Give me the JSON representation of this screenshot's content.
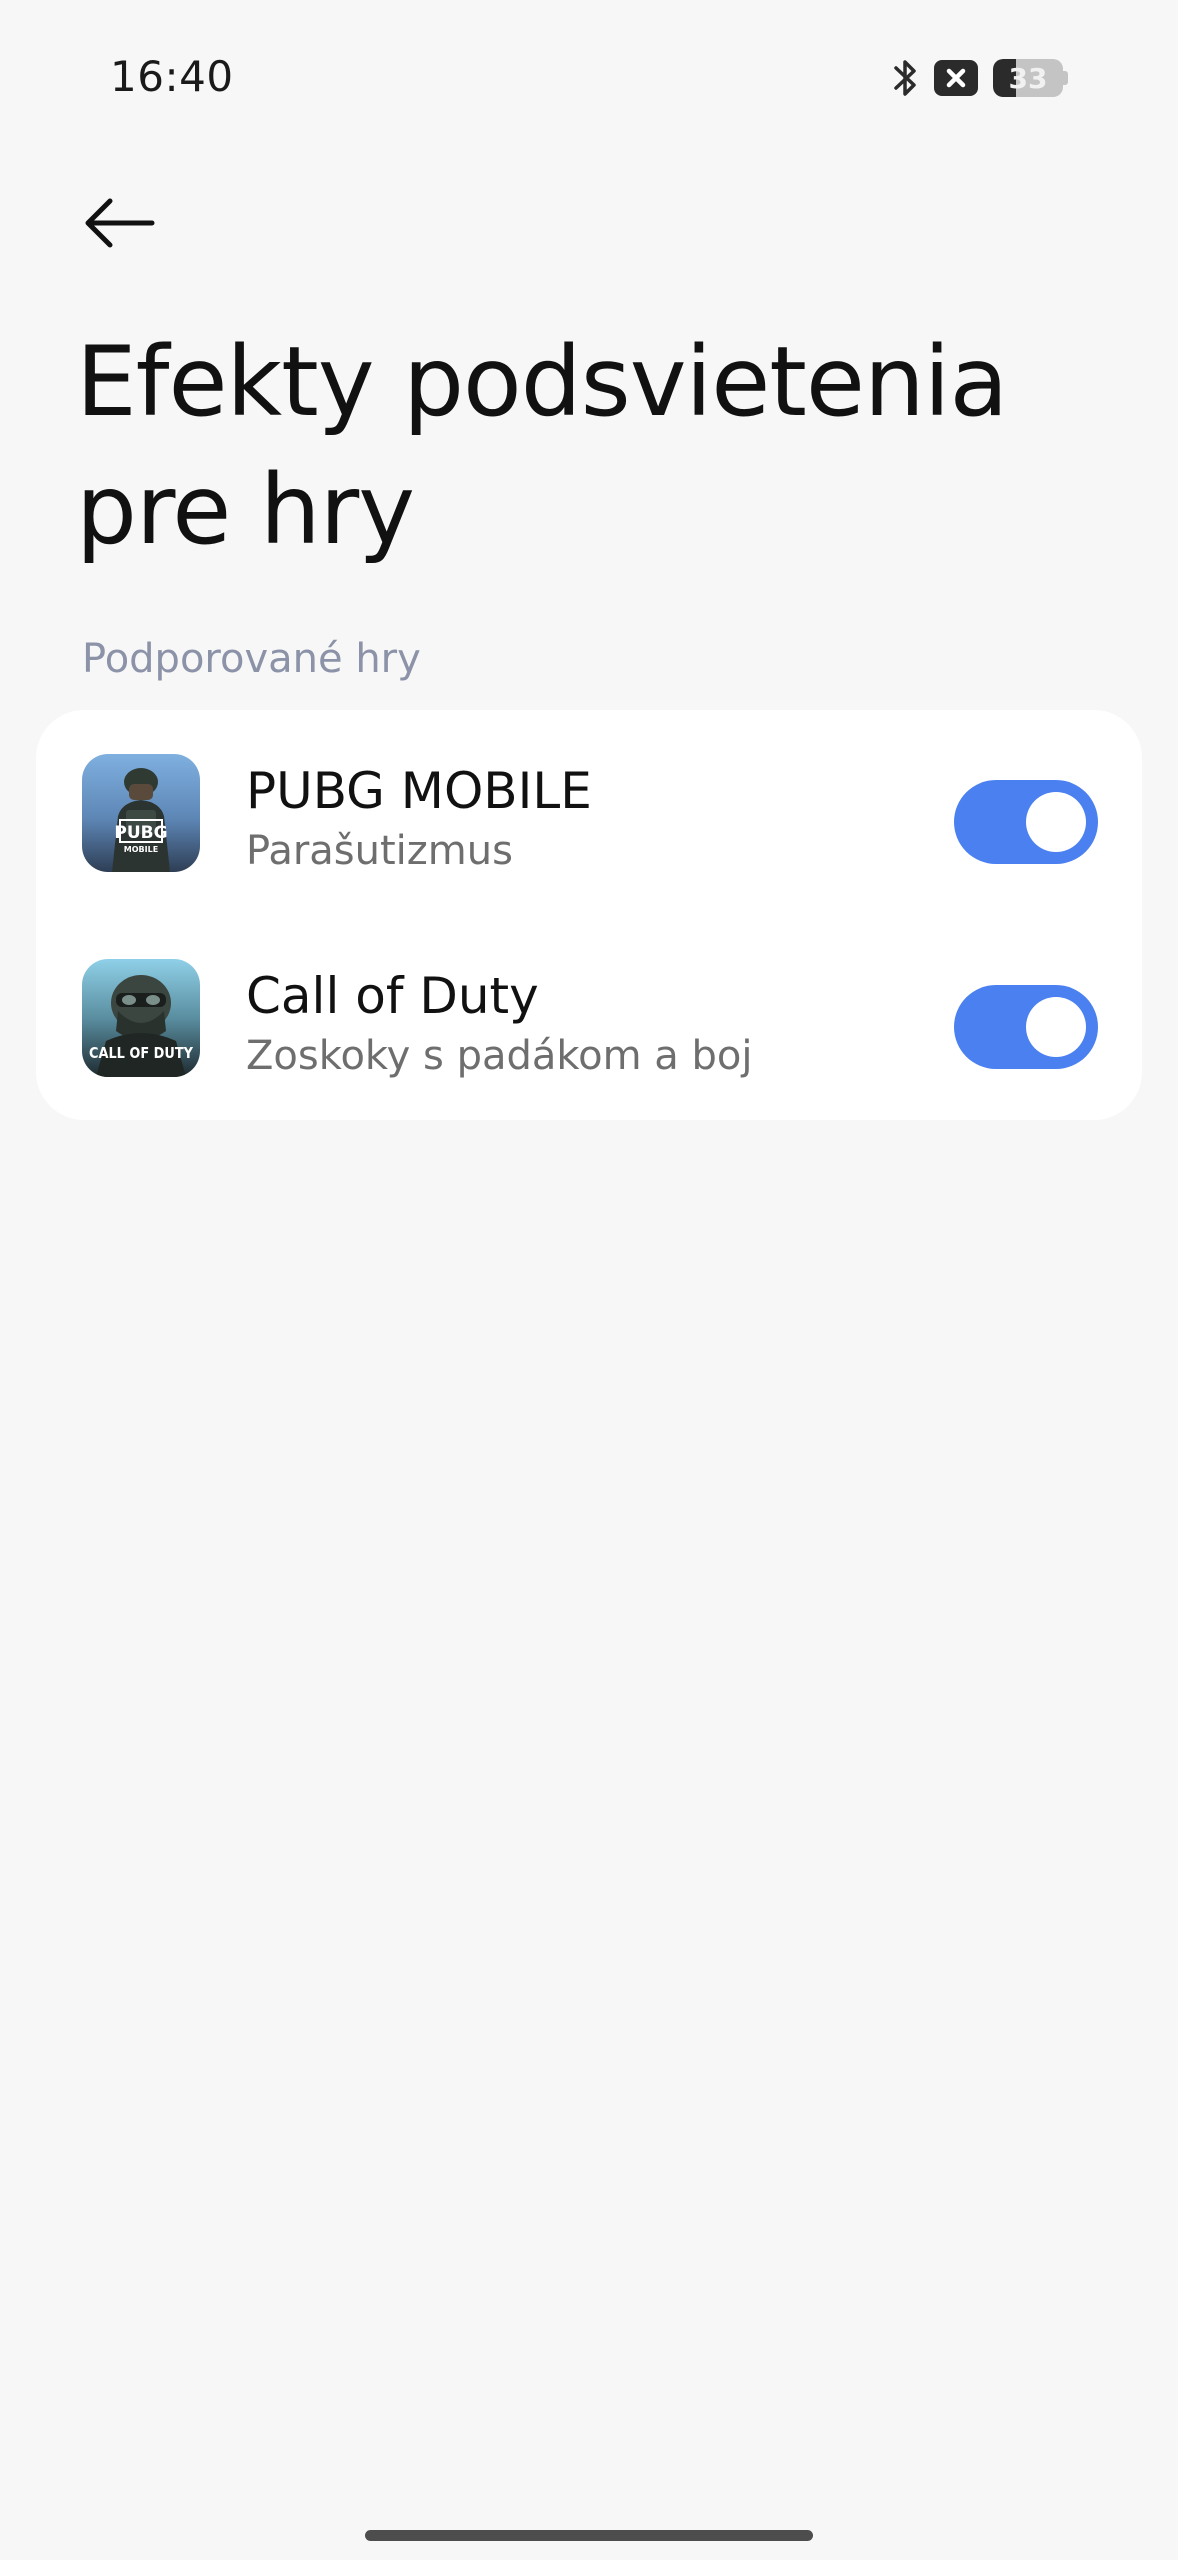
{
  "status_bar": {
    "time": "16:40",
    "battery_level": "33",
    "battery_fraction": 0.33,
    "icons": [
      "bluetooth-icon",
      "sim-error-icon",
      "battery-icon"
    ]
  },
  "header": {
    "back_icon": "arrow-left-icon",
    "title": "Efekty podsvietenia pre hry"
  },
  "section": {
    "header": "Podporované hry"
  },
  "games": [
    {
      "name": "PUBG MOBILE",
      "description": "Parašutizmus",
      "icon": "pubg-mobile-icon",
      "icon_text": "PUBG",
      "icon_subtext": "MOBILE",
      "enabled": true
    },
    {
      "name": "Call of Duty",
      "description": "Zoskoky s padákom a boj",
      "icon": "call-of-duty-icon",
      "icon_text": "CALL OF DUTY",
      "enabled": true
    }
  ],
  "colors": {
    "background": "#f7f7f7",
    "card": "#ffffff",
    "accent": "#4a80f0",
    "section_header": "#8c93a8",
    "secondary_text": "#6e6e6e"
  }
}
